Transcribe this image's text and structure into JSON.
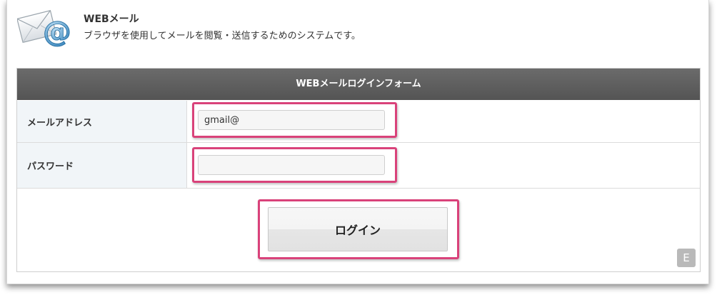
{
  "header": {
    "title": "WEBメール",
    "description": "ブラウザを使用してメールを閲覧・送信するためのシステムです。",
    "icon": "mail-at-icon"
  },
  "form": {
    "title": "WEBメールログインフォーム",
    "email_label": "メールアドレス",
    "email_value": "gmail@",
    "password_label": "パスワード",
    "password_value": "",
    "login_label": "ログイン",
    "badge": "E"
  },
  "colors": {
    "highlight": "#d9427a",
    "header_bar": "#5f5f5f",
    "label_bg": "#f1f5f8"
  }
}
